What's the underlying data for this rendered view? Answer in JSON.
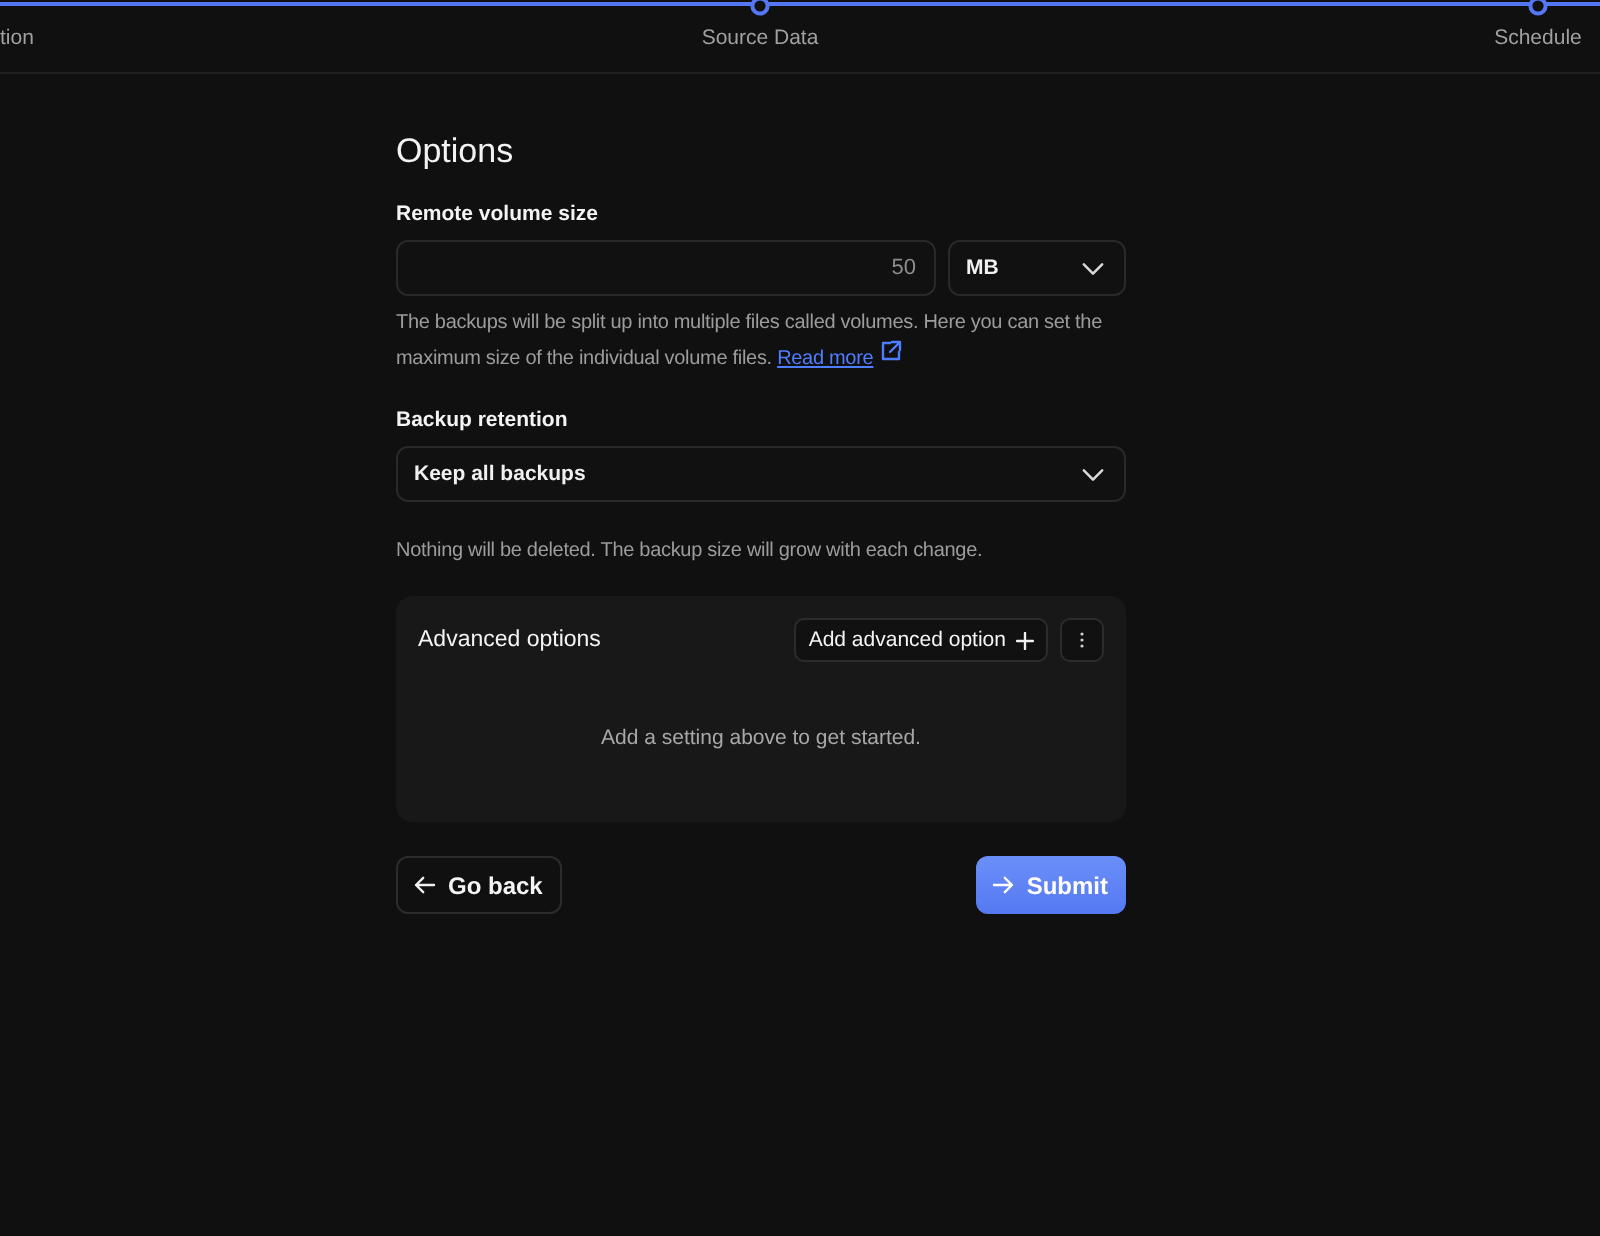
{
  "stepper": {
    "steps": [
      {
        "label": "tion",
        "kind": "cut"
      },
      {
        "label": "Source Data",
        "kind": "step"
      },
      {
        "label": "Schedule",
        "kind": "step"
      }
    ]
  },
  "title": "Options",
  "volume_size": {
    "label": "Remote volume size",
    "value": "50",
    "unit": "MB",
    "help": "The backups will be split up into multiple files called volumes. Here you can set the maximum size of the individual volume files.",
    "link": "Read more"
  },
  "retention": {
    "label": "Backup retention",
    "value": "Keep all backups",
    "help": "Nothing will be deleted. The backup size will grow with each change."
  },
  "advanced": {
    "title": "Advanced options",
    "add_button": "Add advanced option",
    "empty": "Add a setting above to get started."
  },
  "buttons": {
    "back": "Go back",
    "submit": "Submit"
  }
}
